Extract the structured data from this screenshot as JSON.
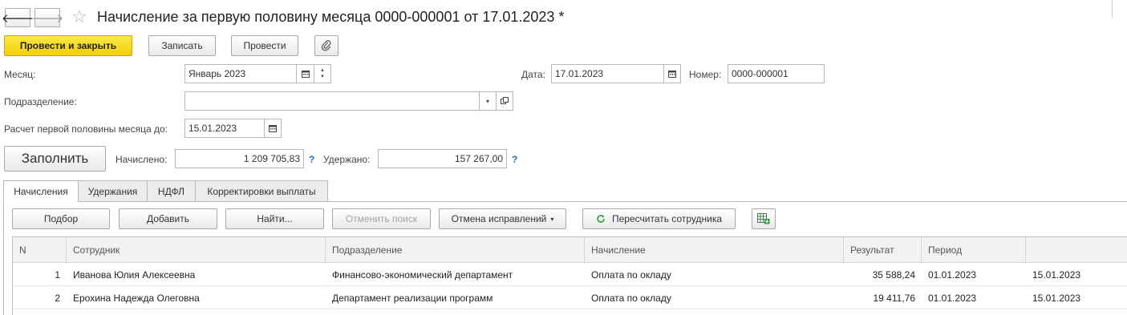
{
  "header": {
    "title": "Начисление за первую половину месяца 0000-000001 от 17.01.2023 *"
  },
  "toolbar": {
    "post_and_close": "Провести и закрыть",
    "save": "Записать",
    "post": "Провести"
  },
  "form": {
    "month_label": "Месяц:",
    "month_value": "Январь 2023",
    "date_label": "Дата:",
    "date_value": "17.01.2023",
    "number_label": "Номер:",
    "number_value": "0000-000001",
    "department_label": "Подразделение:",
    "department_value": "",
    "calc_until_label": "Расчет первой половины месяца до:",
    "calc_until_value": "15.01.2023",
    "fill_button": "Заполнить",
    "accrued_label": "Начислено:",
    "accrued_value": "1 209 705,83",
    "withheld_label": "Удержано:",
    "withheld_value": "157 267,00",
    "help_mark": "?"
  },
  "tabs": [
    {
      "label": "Начисления",
      "active": true
    },
    {
      "label": "Удержания",
      "active": false
    },
    {
      "label": "НДФЛ",
      "active": false
    },
    {
      "label": "Корректировки выплаты",
      "active": false
    }
  ],
  "table_toolbar": {
    "select": "Подбор",
    "add": "Добавить",
    "find": "Найти...",
    "cancel_search": "Отменить поиск",
    "cancel_corrections": "Отмена исправлений",
    "recalc": "Пересчитать сотрудника"
  },
  "table": {
    "columns": [
      "N",
      "Сотрудник",
      "Подразделение",
      "Начисление",
      "Результат",
      "Период",
      ""
    ],
    "rows": [
      [
        "1",
        "Иванова Юлия Алексеевна",
        "Финансово-экономический департамент",
        "Оплата по окладу",
        "35 588,24",
        "01.01.2023",
        "15.01.2023"
      ],
      [
        "2",
        "Ерохина Надежда Олеговна",
        "Департамент реализации программ",
        "Оплата по окладу",
        "19 411,76",
        "01.01.2023",
        "15.01.2023"
      ]
    ]
  },
  "colors": {
    "primary_button": "#f2d003",
    "help_mark": "#2a6db3",
    "recalc_icon": "#2e9b3e"
  },
  "icons": {
    "back": "arrow-left-icon",
    "forward": "arrow-right-icon",
    "favorite": "star-icon",
    "attach": "paperclip-icon",
    "calendar": "calendar-icon",
    "spin": "spin-up-down-icon",
    "dropdown": "chevron-down-icon",
    "open": "open-form-icon",
    "recalc": "refresh-icon",
    "table_settings": "table-add-icon"
  }
}
